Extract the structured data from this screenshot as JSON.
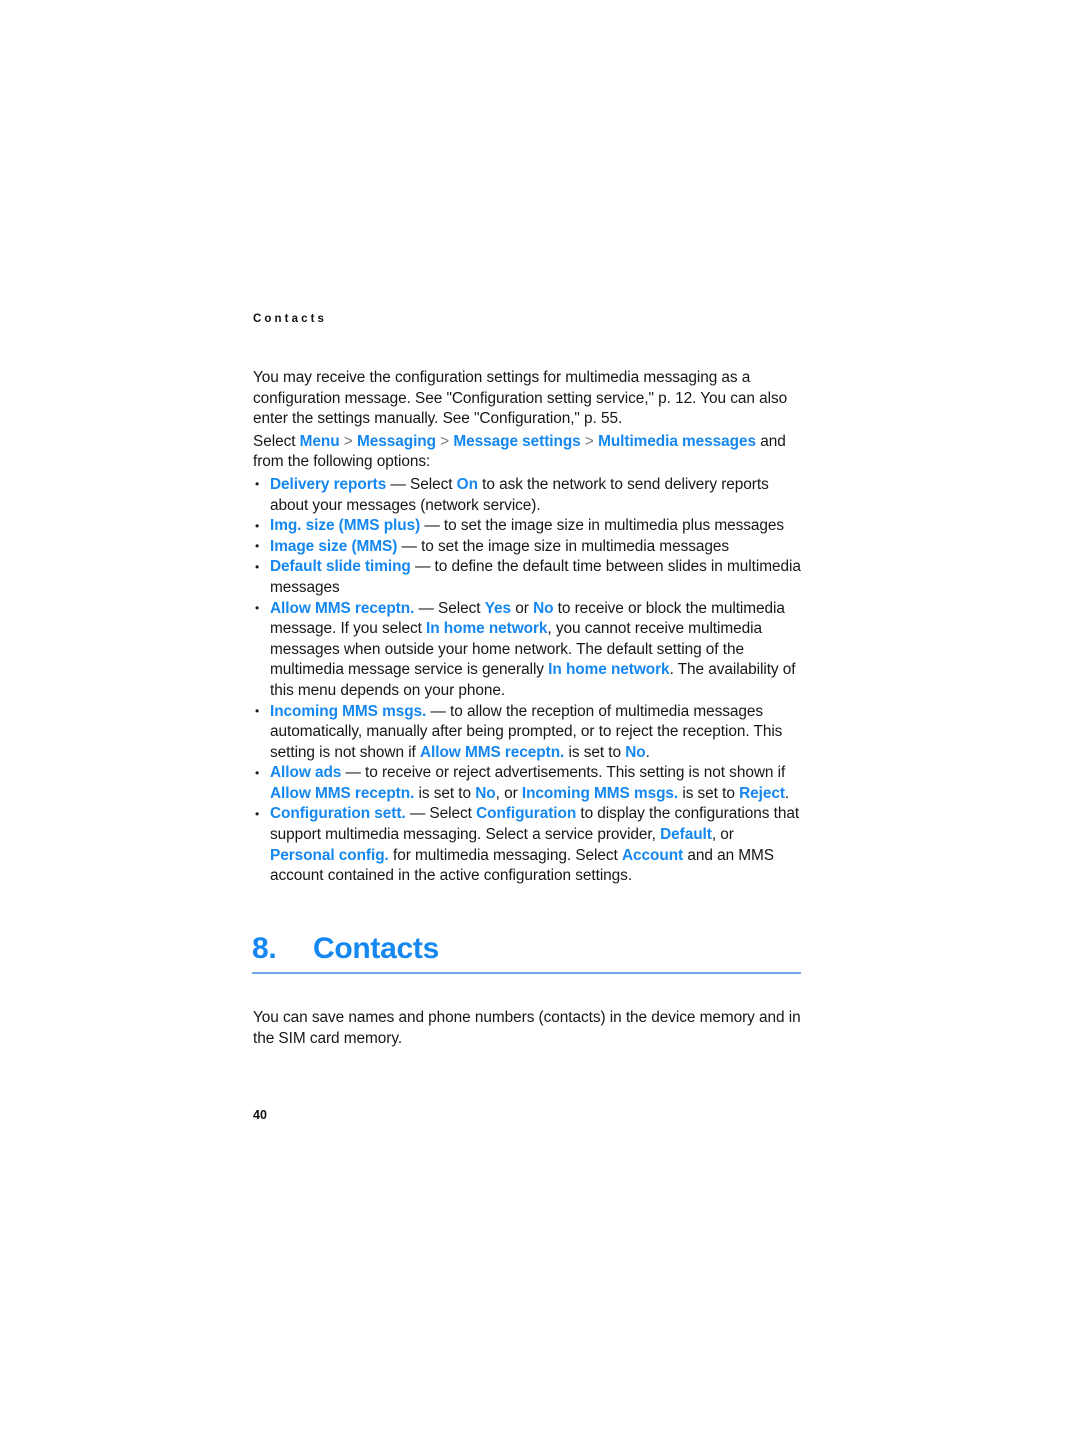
{
  "page": {
    "running_header": "Contacts",
    "folio": "40",
    "accent_blue": "#1487F0",
    "rule_blue": "#6FA8E8",
    "body_color": "#171717"
  },
  "intro": {
    "paragraph": "You may receive the configuration settings for multimedia messaging as a configuration message. See \"Configuration setting service,\" p. 12. You can also enter the settings manually. See \"Configuration,\" p. 55.",
    "select_line": {
      "lead": "Select ",
      "path": [
        "Menu",
        "Messaging",
        "Message settings",
        "Multimedia messages"
      ],
      "separator": ">",
      "tail": " and from the following options:"
    }
  },
  "options": [
    {
      "name": "delivery-reports",
      "term": "Delivery reports",
      "segments": [
        {
          "text": "Delivery reports",
          "style": "key"
        },
        {
          "text": " — Select ",
          "style": "plain"
        },
        {
          "text": "On",
          "style": "key"
        },
        {
          "text": " to ask the network to send delivery reports about your messages (network service).",
          "style": "plain"
        }
      ]
    },
    {
      "name": "img-size-mms-plus",
      "term": "Img. size (MMS plus)",
      "segments": [
        {
          "text": "Img. size (MMS plus)",
          "style": "key"
        },
        {
          "text": " — to set the image size in multimedia plus messages",
          "style": "plain"
        }
      ]
    },
    {
      "name": "image-size-mms",
      "term": "Image size (MMS)",
      "segments": [
        {
          "text": "Image size (MMS)",
          "style": "key"
        },
        {
          "text": " — to set the image size in multimedia messages",
          "style": "plain"
        }
      ]
    },
    {
      "name": "default-slide-timing",
      "term": "Default slide timing",
      "segments": [
        {
          "text": "Default slide timing",
          "style": "key"
        },
        {
          "text": " — to define the default time between slides in multimedia messages",
          "style": "plain"
        }
      ]
    },
    {
      "name": "allow-mms-receptn",
      "term": "Allow MMS receptn.",
      "segments": [
        {
          "text": "Allow MMS receptn.",
          "style": "key"
        },
        {
          "text": " — Select ",
          "style": "plain"
        },
        {
          "text": "Yes",
          "style": "key"
        },
        {
          "text": " or ",
          "style": "plain"
        },
        {
          "text": "No",
          "style": "key"
        },
        {
          "text": " to receive or block the multimedia message. If you select ",
          "style": "plain"
        },
        {
          "text": "In home network",
          "style": "key"
        },
        {
          "text": ", you cannot receive multimedia messages when outside your home network. The default setting of the multimedia message service is generally ",
          "style": "plain"
        },
        {
          "text": "In home network",
          "style": "key"
        },
        {
          "text": ". The availability of this menu depends on your phone.",
          "style": "plain"
        }
      ]
    },
    {
      "name": "incoming-mms-msgs",
      "term": "Incoming MMS msgs.",
      "segments": [
        {
          "text": "Incoming MMS msgs.",
          "style": "key"
        },
        {
          "text": " — to allow the reception of multimedia messages automatically, manually after being prompted, or to reject the reception. This setting is not shown if ",
          "style": "plain"
        },
        {
          "text": "Allow MMS receptn.",
          "style": "key"
        },
        {
          "text": " is set to ",
          "style": "plain"
        },
        {
          "text": "No",
          "style": "key"
        },
        {
          "text": ".",
          "style": "plain"
        }
      ]
    },
    {
      "name": "allow-ads",
      "term": "Allow ads",
      "segments": [
        {
          "text": "Allow ads",
          "style": "key"
        },
        {
          "text": " — to receive or reject advertisements. This setting is not shown if ",
          "style": "plain"
        },
        {
          "text": "Allow MMS receptn.",
          "style": "key"
        },
        {
          "text": " is set to ",
          "style": "plain"
        },
        {
          "text": "No",
          "style": "key"
        },
        {
          "text": ", or ",
          "style": "plain"
        },
        {
          "text": "Incoming MMS msgs.",
          "style": "key"
        },
        {
          "text": " is set to ",
          "style": "plain"
        },
        {
          "text": "Reject",
          "style": "key"
        },
        {
          "text": ".",
          "style": "plain"
        }
      ]
    },
    {
      "name": "configuration-sett",
      "term": "Configuration sett.",
      "segments": [
        {
          "text": "Configuration sett.",
          "style": "key"
        },
        {
          "text": " — Select ",
          "style": "plain"
        },
        {
          "text": "Configuration",
          "style": "key"
        },
        {
          "text": " to display the configurations that support multimedia messaging. Select a service provider, ",
          "style": "plain"
        },
        {
          "text": "Default",
          "style": "key"
        },
        {
          "text": ", or ",
          "style": "plain"
        },
        {
          "text": "Personal config.",
          "style": "key"
        },
        {
          "text": " for multimedia messaging. Select ",
          "style": "plain"
        },
        {
          "text": "Account",
          "style": "key"
        },
        {
          "text": " and an MMS account contained in the active configuration settings.",
          "style": "plain"
        }
      ]
    }
  ],
  "chapter": {
    "number": "8.",
    "title": "Contacts",
    "paragraph": "You can save names and phone numbers (contacts) in the device memory and in the SIM card memory."
  }
}
